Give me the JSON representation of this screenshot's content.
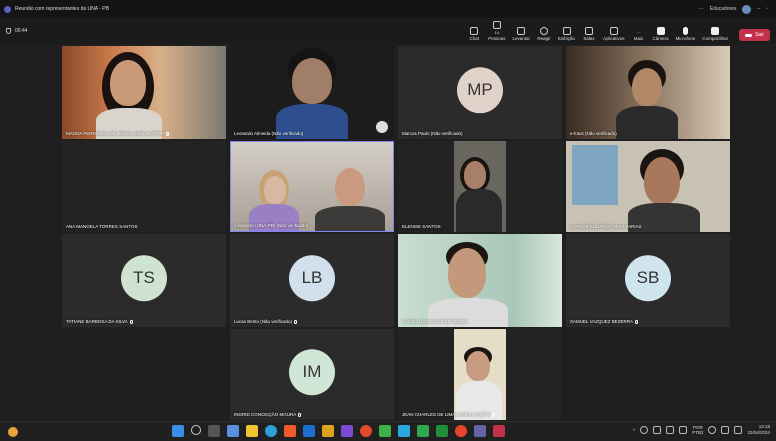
{
  "window": {
    "title": "Reunião com representantes da UNA - PB",
    "user_name": "Educadores",
    "minimize": "–",
    "restore": "▫"
  },
  "toolbar": {
    "timer": "00:44",
    "items": [
      {
        "label": "Chat",
        "count": ""
      },
      {
        "label": "Pessoas",
        "count": "14"
      },
      {
        "label": "Levantar",
        "count": ""
      },
      {
        "label": "Reagir",
        "count": ""
      },
      {
        "label": "Exibição",
        "count": ""
      },
      {
        "label": "Salas",
        "count": ""
      },
      {
        "label": "Aplicativos",
        "count": ""
      },
      {
        "label": "Mais",
        "count": ""
      },
      {
        "label": "Câmera",
        "count": ""
      },
      {
        "label": "Microfone",
        "count": ""
      },
      {
        "label": "Compartilhar",
        "count": ""
      }
    ],
    "leave_label": "Sair"
  },
  "participants": [
    {
      "name": "MAGDA FERNANDA DE MOURA DOS SANTOS",
      "initials": "",
      "muted": true
    },
    {
      "name": "Leonardo Almeida (Não verificado)",
      "initials": "",
      "muted": false
    },
    {
      "name": "Marcos Paulo (Não verificado)",
      "initials": "MP",
      "muted": false
    },
    {
      "name": "e-fotus (Não verificado)",
      "initials": "",
      "muted": false
    },
    {
      "name": "ANA MANOELA TORRES SANTOS",
      "initials": "",
      "muted": false
    },
    {
      "name": "Leonardo (UNA-PB) (Não verificado)",
      "initials": "",
      "muted": false
    },
    {
      "name": "ELENISE SANTOS",
      "initials": "",
      "muted": false
    },
    {
      "name": "CARLOS EDUARDO MAIA FARIAS",
      "initials": "",
      "muted": false
    },
    {
      "name": "TATIANE BARBOSA DA SILVA",
      "initials": "TS",
      "muted": true
    },
    {
      "name": "Lucas Bento (Não verificado)",
      "initials": "LB",
      "muted": true
    },
    {
      "name": "KAIKE LUCAS DIAS DE SOUZA",
      "initials": "",
      "muted": false
    },
    {
      "name": "SAMUEL VAZQUEZ BEZERRA",
      "initials": "SB",
      "muted": true
    },
    {
      "name": "INGRID CONCEIÇÃO MOURA",
      "initials": "IM",
      "muted": true
    },
    {
      "name": "JEAN CHARLES DE LIMA SAMPAIO NETO",
      "initials": "",
      "muted": true
    }
  ],
  "taskbar": {
    "lang_top": "POR",
    "lang_bottom": "PTB2",
    "time": "12:18",
    "date": "22/04/2024"
  },
  "colors": {
    "initials_bg": "#cfe3d2",
    "leave": "#c4314b",
    "tile_bg": "#2b2b2b",
    "active_border": "#7f85f5"
  }
}
